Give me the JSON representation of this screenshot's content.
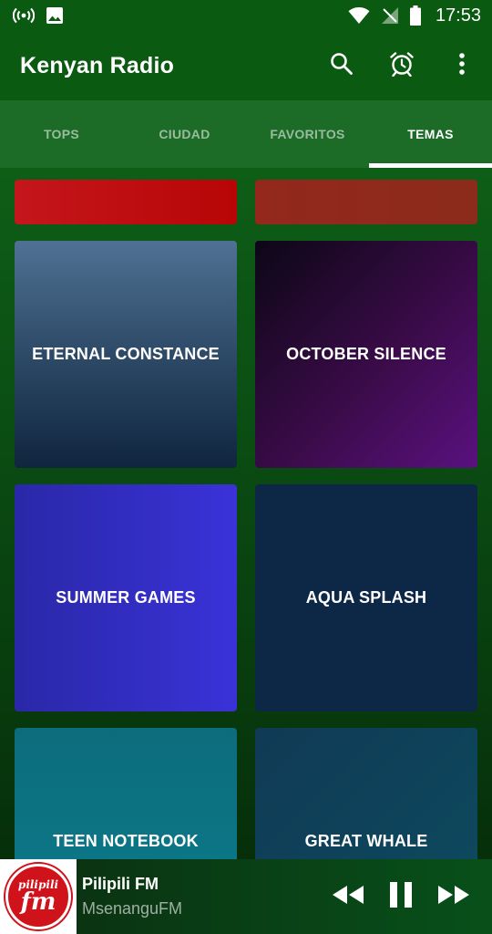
{
  "status_bar": {
    "time": "17:53",
    "icons": [
      "hotspot-icon",
      "image-icon",
      "wifi-icon",
      "no-signal-icon",
      "battery-icon"
    ]
  },
  "app_bar": {
    "title": "Kenyan Radio",
    "actions": [
      "search-icon",
      "alarm-icon",
      "more-vert-icon"
    ]
  },
  "tabs": [
    {
      "label": "TOPS",
      "active": false
    },
    {
      "label": "CIUDAD",
      "active": false
    },
    {
      "label": "FAVORITOS",
      "active": false
    },
    {
      "label": "TEMAS",
      "active": true
    }
  ],
  "themes": [
    {
      "name": "",
      "color": "#c4161c"
    },
    {
      "name": "",
      "color": "#8f2a1c"
    },
    {
      "name": "ETERNAL CONSTANCE",
      "color": "#2d4a67"
    },
    {
      "name": "OCTOBER SILENCE",
      "color": "#3a0b48"
    },
    {
      "name": "SUMMER GAMES",
      "color": "#3330c8"
    },
    {
      "name": "AQUA SPLASH",
      "color": "#0c2846"
    },
    {
      "name": "TEEN NOTEBOOK",
      "color": "#0b7585"
    },
    {
      "name": "GREAT WHALE",
      "color": "#0f4459"
    }
  ],
  "player": {
    "station": "Pilipili FM",
    "subtitle": "MsenanguFM",
    "logo_text_top": "pilipili",
    "logo_text_bottom": "fm",
    "controls": [
      "rewind-icon",
      "pause-icon",
      "fast-forward-icon"
    ]
  },
  "colors": {
    "primary": "#0b5a12",
    "tab_bar": "#1c6b27",
    "indicator": "#ffffff"
  }
}
